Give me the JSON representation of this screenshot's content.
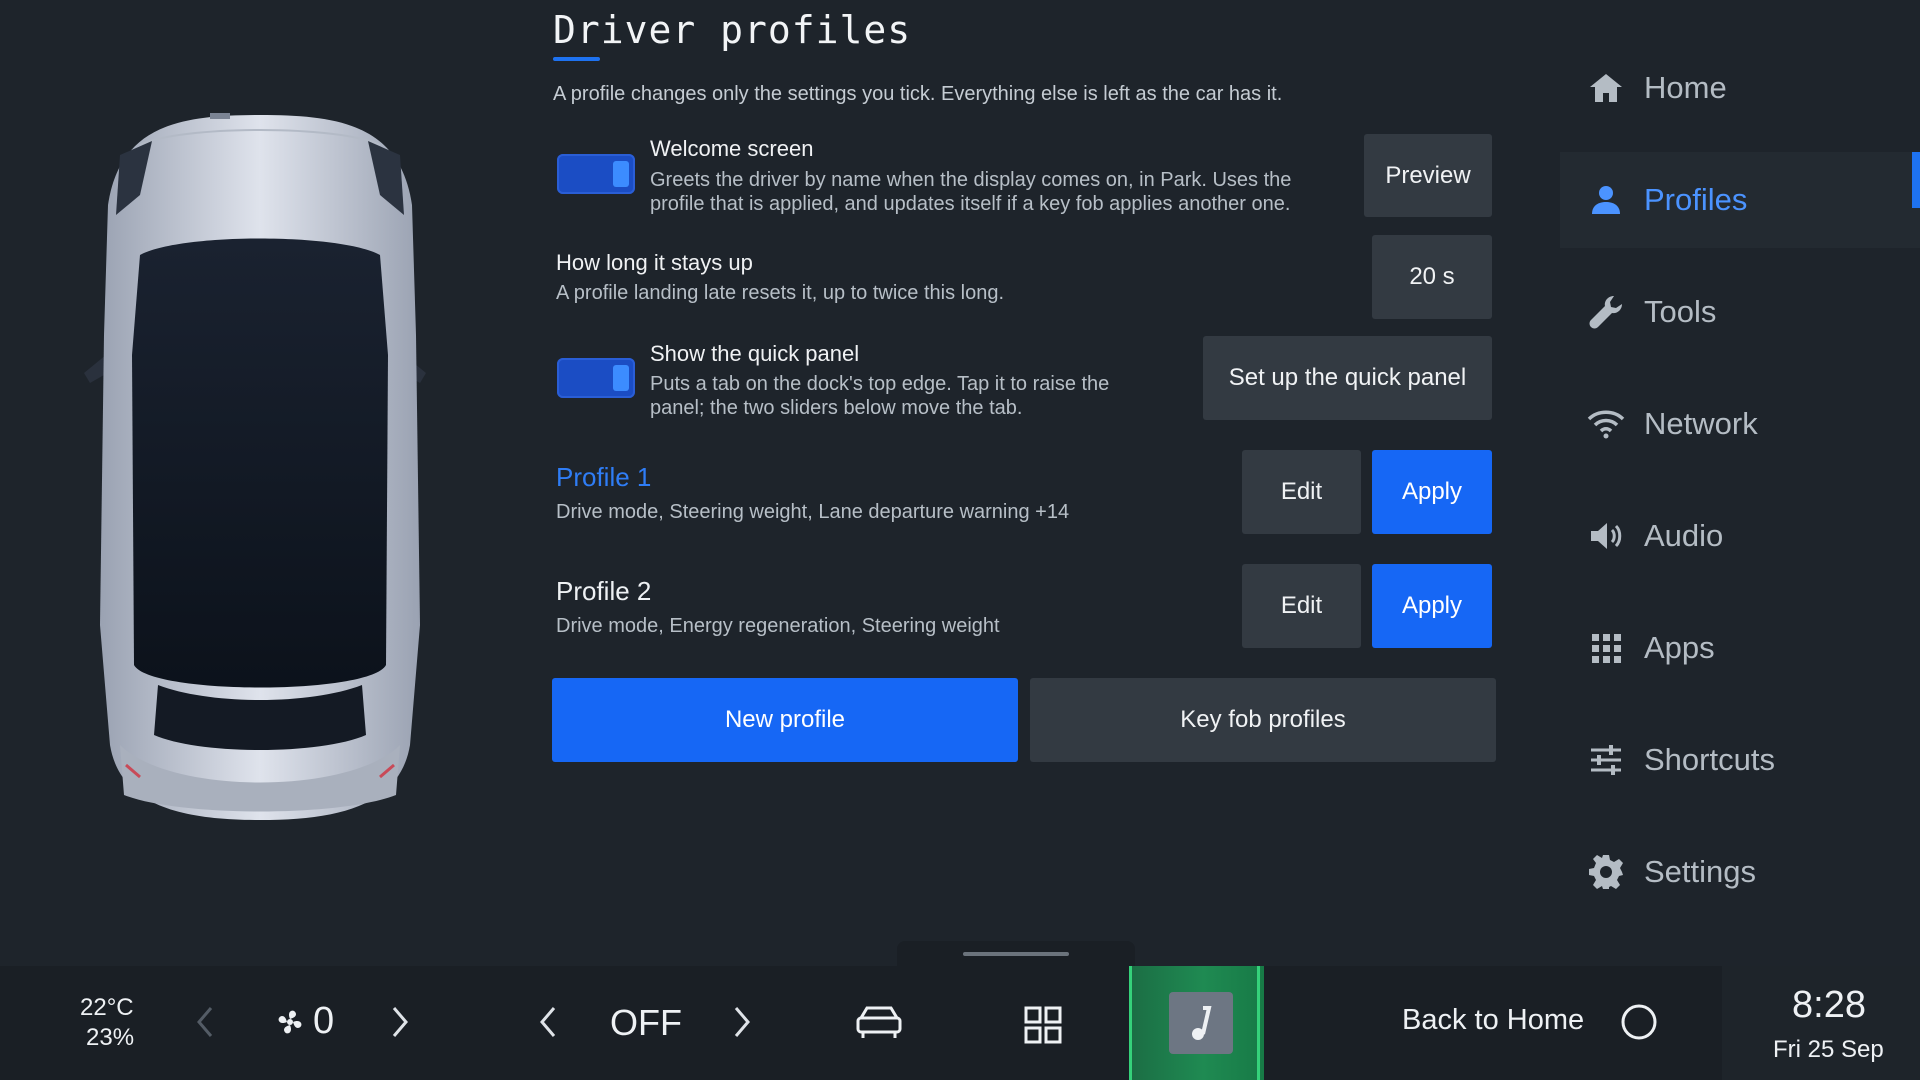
{
  "page": {
    "title": "Driver profiles",
    "description": "A profile changes only the settings you tick. Everything else is left as the car has it."
  },
  "welcome": {
    "title": "Welcome screen",
    "desc_line1": "Greets the driver by name when the display comes on, in Park. Uses the",
    "desc_line2": "profile that is applied, and updates itself if a key fob applies another one.",
    "toggle_on": true,
    "preview_label": "Preview"
  },
  "duration": {
    "title": "How long it stays up",
    "desc": "A profile landing late resets it, up to twice this long.",
    "value": "20 s"
  },
  "quick_panel": {
    "title": "Show the quick panel",
    "desc_line1": "Puts a tab on the dock's top edge. Tap it to raise the",
    "desc_line2": "panel; the two sliders below move the tab.",
    "toggle_on": true,
    "setup_label": "Set up the quick panel"
  },
  "profiles": [
    {
      "name": "Profile 1",
      "settings": "Drive mode, Steering weight, Lane departure warning +14",
      "active": true,
      "edit_label": "Edit",
      "apply_label": "Apply"
    },
    {
      "name": "Profile 2",
      "settings": "Drive mode, Energy regeneration, Steering weight",
      "active": false,
      "edit_label": "Edit",
      "apply_label": "Apply"
    }
  ],
  "actions": {
    "new_profile": "New profile",
    "key_fob_profiles": "Key fob profiles"
  },
  "nav": {
    "items": [
      {
        "label": "Home",
        "icon": "home-icon",
        "active": false
      },
      {
        "label": "Profiles",
        "icon": "person-icon",
        "active": true
      },
      {
        "label": "Tools",
        "icon": "wrench-icon",
        "active": false
      },
      {
        "label": "Network",
        "icon": "wifi-icon",
        "active": false
      },
      {
        "label": "Audio",
        "icon": "speaker-icon",
        "active": false
      },
      {
        "label": "Apps",
        "icon": "grid-icon",
        "active": false
      },
      {
        "label": "Shortcuts",
        "icon": "sliders-icon",
        "active": false
      },
      {
        "label": "Settings",
        "icon": "gear-icon",
        "active": false
      }
    ]
  },
  "dock": {
    "temperature": "22°C",
    "humidity": "23%",
    "fan_speed": "0",
    "seat_heat": "OFF",
    "back_home": "Back to Home",
    "time": "8:28",
    "date": "Fri 25 Sep"
  },
  "colors": {
    "accent": "#1667f5",
    "active_text": "#4b93ff",
    "background": "#1e242b",
    "button": "#333a42"
  }
}
